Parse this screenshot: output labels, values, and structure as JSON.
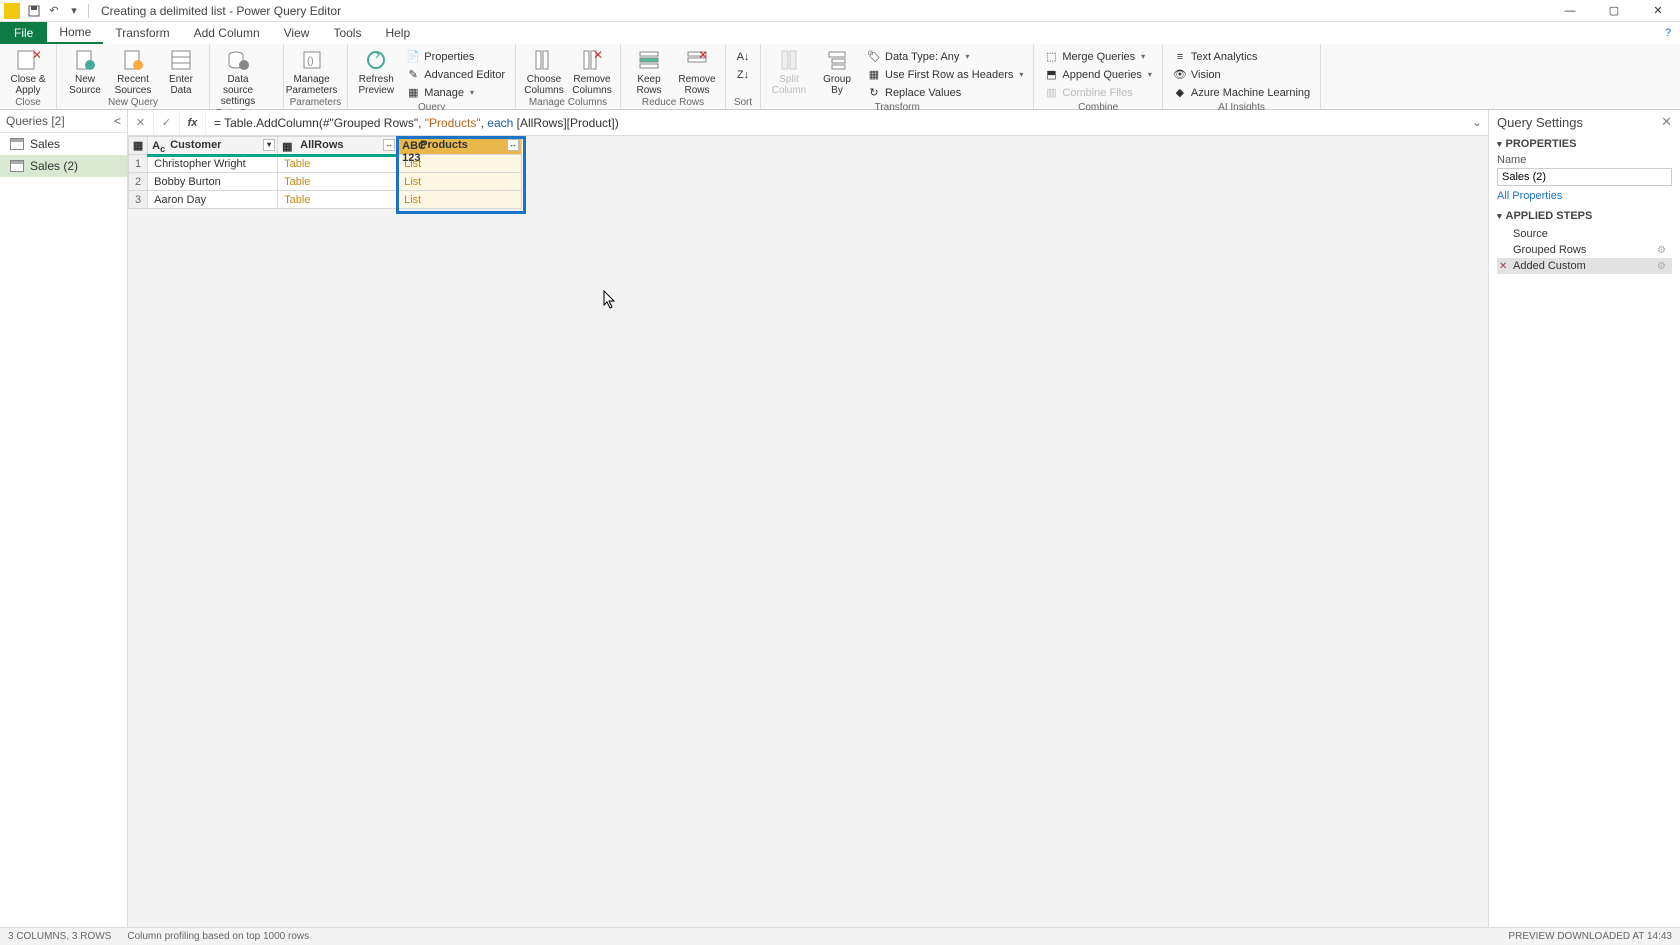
{
  "title": "Creating a delimited list - Power Query Editor",
  "tabs": {
    "file": "File",
    "home": "Home",
    "transform": "Transform",
    "addcol": "Add Column",
    "view": "View",
    "tools": "Tools",
    "help": "Help"
  },
  "ribbon": {
    "close": {
      "closeApply": "Close &\nApply",
      "group": "Close"
    },
    "newquery": {
      "newSource": "New\nSource",
      "recentSources": "Recent\nSources",
      "enterData": "Enter\nData",
      "group": "New Query"
    },
    "datasources": {
      "settings": "Data source\nsettings",
      "group": "Data Sources"
    },
    "parameters": {
      "manage": "Manage\nParameters",
      "group": "Parameters"
    },
    "query": {
      "refresh": "Refresh\nPreview",
      "properties": "Properties",
      "advEditor": "Advanced Editor",
      "manage": "Manage",
      "group": "Query"
    },
    "manageCols": {
      "choose": "Choose\nColumns",
      "remove": "Remove\nColumns",
      "group": "Manage Columns"
    },
    "reduceRows": {
      "keep": "Keep\nRows",
      "remove": "Remove\nRows",
      "group": "Reduce Rows"
    },
    "sort": {
      "group": "Sort"
    },
    "transform": {
      "split": "Split\nColumn",
      "groupby": "Group\nBy",
      "dataType": "Data Type: Any",
      "firstRow": "Use First Row as Headers",
      "replace": "Replace Values",
      "group": "Transform"
    },
    "combine": {
      "merge": "Merge Queries",
      "append": "Append Queries",
      "combineFiles": "Combine Files",
      "group": "Combine"
    },
    "ai": {
      "textAnalytics": "Text Analytics",
      "vision": "Vision",
      "azureML": "Azure Machine Learning",
      "group": "AI Insights"
    }
  },
  "queriesPane": {
    "title": "Queries [2]",
    "items": [
      "Sales",
      "Sales (2)"
    ],
    "selected": 1
  },
  "formula": {
    "prefix": "= Table.AddColumn(#\"Grouped Rows\", ",
    "str": "\"Products\"",
    "mid": ", ",
    "kw": "each",
    "suffix": " [AllRows][Product])"
  },
  "grid": {
    "columns": [
      "Customer",
      "AllRows",
      "Products"
    ],
    "rows": [
      {
        "n": "1",
        "customer": "Christopher Wright",
        "allrows": "Table",
        "products": "List"
      },
      {
        "n": "2",
        "customer": "Bobby Burton",
        "allrows": "Table",
        "products": "List"
      },
      {
        "n": "3",
        "customer": "Aaron Day",
        "allrows": "Table",
        "products": "List"
      }
    ]
  },
  "settings": {
    "title": "Query Settings",
    "properties": "PROPERTIES",
    "nameLabel": "Name",
    "nameValue": "Sales (2)",
    "allProps": "All Properties",
    "applied": "APPLIED STEPS",
    "steps": [
      "Source",
      "Grouped Rows",
      "Added Custom"
    ],
    "selectedStep": 2
  },
  "status": {
    "left": "3 COLUMNS, 3 ROWS",
    "mid": "Column profiling based on top 1000 rows",
    "right": "PREVIEW DOWNLOADED AT 14:43"
  }
}
